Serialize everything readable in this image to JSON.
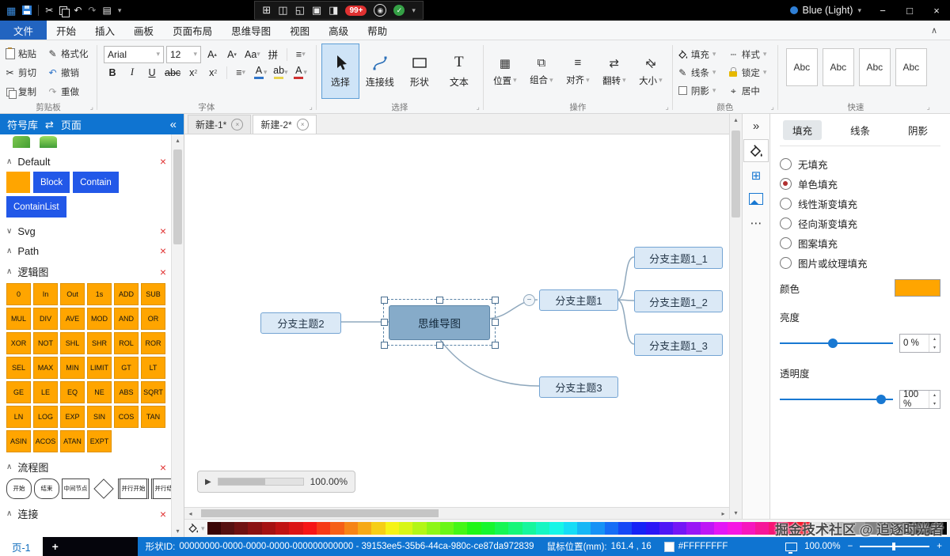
{
  "icons": {
    "app": "▦",
    "cut": "✂",
    "undo": "↶",
    "redo": "↷",
    "board": "▤",
    "caret": "▾",
    "collapse": "«",
    "expand": "»",
    "up": "∧",
    "down": "∨",
    "close": "×",
    "minimize": "−",
    "maximize": "□",
    "dots": "⋯",
    "check": "✓",
    "play": "▶",
    "swap": "⇄",
    "launcher": "⌟",
    "minus": "−",
    "plus": "+",
    "left": "◂",
    "right": "▸",
    "uptri": "▴",
    "downtri": "▾",
    "center": "⌖",
    "dash": "┄",
    "pencil": "✎",
    "grid": "⊞",
    "text": "T",
    "list": "≡"
  },
  "titlebar": {
    "theme": "Blue (Light)",
    "badge": "99+",
    "center_icons": [
      {
        "name": "flowchart",
        "glyph": "⊞"
      },
      {
        "name": "camera",
        "glyph": "◫"
      },
      {
        "name": "pointer",
        "glyph": "◱"
      },
      {
        "name": "window-capture",
        "glyph": "▣"
      },
      {
        "name": "screen",
        "glyph": "◨"
      }
    ]
  },
  "menubar": {
    "file": "文件",
    "tabs": [
      "开始",
      "插入",
      "画板",
      "页面布局",
      "思维导图",
      "视图",
      "高级",
      "帮助"
    ]
  },
  "ribbon": {
    "clipboard": {
      "label": "剪贴板",
      "paste": "粘贴",
      "format": "格式化",
      "cut": "剪切",
      "undo": "撤销",
      "copy": "复制",
      "redo": "重做"
    },
    "font": {
      "label": "字体",
      "family": "Arial",
      "size": "12",
      "grow": "A",
      "shrink": "A",
      "case": "Aa",
      "phonetic": "拼",
      "bold": "B",
      "italic": "I",
      "underline": "U",
      "strike": "abc",
      "subx": "x",
      "subn": "2",
      "supx": "x",
      "supn": "2",
      "colora": "A",
      "highlight": "ab"
    },
    "select": {
      "label": "选择",
      "select": "选择",
      "connector": "连接线",
      "shape": "形状",
      "text": "文本"
    },
    "ops": {
      "label": "操作",
      "items": [
        {
          "label": "位置",
          "icon": "position",
          "glyph": "▦"
        },
        {
          "label": "组合",
          "icon": "group",
          "glyph": "⧉"
        },
        {
          "label": "对齐",
          "icon": "align",
          "glyph": "≡"
        },
        {
          "label": "翻转",
          "icon": "flip",
          "glyph": "⇄"
        },
        {
          "label": "大小",
          "icon": "size",
          "glyph": "⇄"
        }
      ]
    },
    "color": {
      "label": "颜色",
      "fill": "填充",
      "style": "样式",
      "line": "线条",
      "lock": "锁定",
      "shadow": "阴影",
      "center": "居中"
    },
    "quick": {
      "label": "快速",
      "samples": [
        "Abc",
        "Abc",
        "Abc",
        "Abc"
      ]
    }
  },
  "sidebar": {
    "symbols_tab": "符号库",
    "pages_tab": "页面",
    "sections": {
      "default": {
        "name": "Default",
        "blocks": [
          "Block",
          "Contain",
          "ContainList"
        ]
      },
      "svg": {
        "name": "Svg"
      },
      "path": {
        "name": "Path"
      },
      "logic": {
        "name": "逻辑图",
        "items": [
          "0",
          "In",
          "Out",
          "1s",
          "ADD",
          "SUB",
          "MUL",
          "DIV",
          "AVE",
          "MOD",
          "AND",
          "OR",
          "XOR",
          "NOT",
          "SHL",
          "SHR",
          "ROL",
          "ROR",
          "SEL",
          "MAX",
          "MIN",
          "LIMIT",
          "GT",
          "LT",
          "GE",
          "LE",
          "EQ",
          "NE",
          "ABS",
          "SQRT",
          "LN",
          "LOG",
          "EXP",
          "SIN",
          "COS",
          "TAN",
          "ASIN",
          "ACOS",
          "ATAN",
          "EXPT"
        ]
      },
      "flow": {
        "name": "流程图",
        "items": [
          {
            "label": "开始",
            "kind": "round"
          },
          {
            "label": "结束",
            "kind": "round"
          },
          {
            "label": "中间节点",
            "kind": "rect"
          },
          {
            "label": "",
            "kind": "diamond"
          },
          {
            "label": "并行开始",
            "kind": "par"
          },
          {
            "label": "并行结束",
            "kind": "par"
          }
        ]
      },
      "extra": {
        "name": "连接"
      }
    }
  },
  "canvas": {
    "tabs": [
      "新建-1*",
      "新建-2*"
    ],
    "zoom": "100.00%"
  },
  "mindmap": {
    "center": "思维导图",
    "left": "分支主题2",
    "right": "分支主题1",
    "child1": "分支主题1_1",
    "child2": "分支主题1_2",
    "child3": "分支主题1_3",
    "bottom": "分支主题3"
  },
  "panel": {
    "tabs": [
      "填充",
      "线条",
      "阴影"
    ],
    "active_tab": "填充",
    "options": [
      "无填充",
      "单色填充",
      "线性渐变填充",
      "径向渐变填充",
      "图案填充",
      "图片或纹理填充"
    ],
    "selected": "单色填充",
    "color_label": "颜色",
    "swatch": "#FFA500",
    "brightness_label": "亮度",
    "brightness_value": "0 %",
    "opacity_label": "透明度",
    "opacity_value": "100 %"
  },
  "palette": {
    "watermark": "掘金技术社区 @ 追逐时光者",
    "colors": [
      "#3a0505",
      "#561010",
      "#6f1111",
      "#8a1111",
      "#a51212",
      "#c01313",
      "#db1414",
      "#f61515",
      "#f63a15",
      "#f65f15",
      "#f68415",
      "#f6a915",
      "#f6ce15",
      "#f6f315",
      "#d8f615",
      "#b3f615",
      "#8ef615",
      "#69f615",
      "#44f615",
      "#1ff615",
      "#15f62e",
      "#15f653",
      "#15f678",
      "#15f69d",
      "#15f6c2",
      "#15f6e7",
      "#15dcf6",
      "#15b7f6",
      "#1592f6",
      "#156df6",
      "#1548f6",
      "#1523f6",
      "#2a15f6",
      "#4f15f6",
      "#7415f6",
      "#9915f6",
      "#be15f6",
      "#e315f6",
      "#f615e3",
      "#f615be",
      "#f61599",
      "#f61574",
      "#f6154f",
      "#f6152a",
      "#e6e6e6",
      "#cccccc",
      "#b3b3b3",
      "#999999",
      "#808080",
      "#666666",
      "#4d4d4d",
      "#333333",
      "#1a1a1a",
      "#000000"
    ]
  },
  "statusbar": {
    "page_tab": "页-1",
    "shape_id_label": "形状ID:",
    "shape_id": "00000000-0000-0000-0000-000000000000 - 39153ee5-35b6-44ca-980c-ce87da972839",
    "mouse_label": "鼠标位置(mm):",
    "mouse_value": "161.4 , 16",
    "fill_hex": "#FFFFFFFF",
    "zoom": "100.00%"
  }
}
